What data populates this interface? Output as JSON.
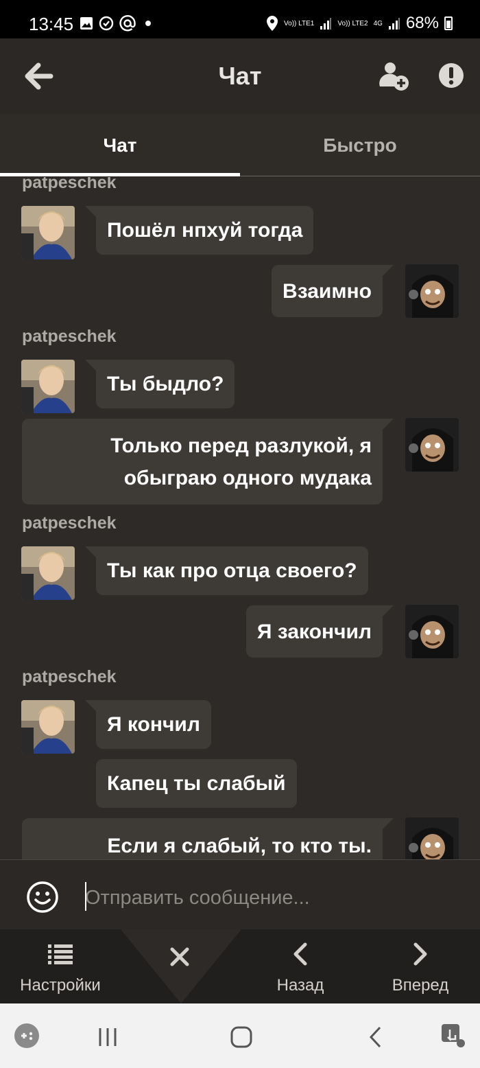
{
  "status_bar": {
    "time": "13:45",
    "network_1": "Vo)) LTE1",
    "network_2": "Vo)) LTE2",
    "network_type": "4G",
    "battery": "68%",
    "icons_left": [
      "image-icon",
      "sync-icon",
      "at-icon",
      "dot-icon"
    ],
    "icons_right": [
      "location-icon",
      "signal-icon",
      "battery-icon"
    ]
  },
  "header": {
    "title": "Чат",
    "back_icon": "arrow-left-icon",
    "add_user_icon": "add-user-icon",
    "report_icon": "exclamation-icon"
  },
  "tabs": [
    {
      "label": "Чат",
      "active": true
    },
    {
      "label": "Быстро",
      "active": false
    }
  ],
  "messages": [
    {
      "type": "name",
      "text": "patpeschek"
    },
    {
      "type": "in",
      "text": "Пошёл нпхуй тогда"
    },
    {
      "type": "out",
      "text": "Взаимно"
    },
    {
      "type": "name",
      "text": "patpeschek"
    },
    {
      "type": "in",
      "text": "Ты быдло?"
    },
    {
      "type": "out",
      "lines": [
        "Только перед разлукой, я",
        "обыграю одного мудака"
      ]
    },
    {
      "type": "name",
      "text": "patpeschek"
    },
    {
      "type": "in",
      "text": "Ты как про отца своего?"
    },
    {
      "type": "out",
      "text": "Я закончил"
    },
    {
      "type": "name",
      "text": "patpeschek"
    },
    {
      "type": "in",
      "text": "Я кончил"
    },
    {
      "type": "in",
      "text": "Капец ты слабый"
    },
    {
      "type": "out",
      "text": "Если я слабый, то кто ты."
    }
  ],
  "composer": {
    "placeholder": "Отправить сообщение...",
    "emoji_icon": "smiley-icon"
  },
  "bottom_nav": {
    "settings": "Настройки",
    "back": "Назад",
    "forward": "Вперед",
    "close_icon": "close-icon"
  },
  "colors": {
    "background": "#2d2a27",
    "bubble": "#3e3a36",
    "text": "#ffffff",
    "username": "#aeaaa5"
  }
}
